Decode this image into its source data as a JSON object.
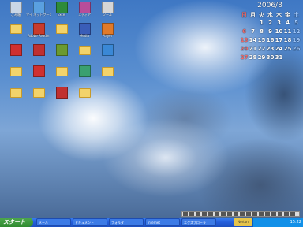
{
  "desktop": {
    "icons": [
      {
        "label": "ごみ箱",
        "color": "#c9d6e6",
        "kind": "app"
      },
      {
        "label": "マイ ネットワーク",
        "color": "#5aa0e0",
        "kind": "app"
      },
      {
        "label": "Excel",
        "color": "#2e8b3a",
        "kind": "app"
      },
      {
        "label": "メディア",
        "color": "#b84d9a",
        "kind": "app"
      },
      {
        "label": "ツール",
        "color": "#d6d6d6",
        "kind": "app"
      },
      {
        "label": "",
        "color": "#f2d36b",
        "kind": "folder"
      },
      {
        "label": "Adobe Reader",
        "color": "#c83a2c",
        "kind": "app"
      },
      {
        "label": "",
        "color": "#f2d36b",
        "kind": "folder"
      },
      {
        "label": "Media",
        "color": "#3a5db8",
        "kind": "app"
      },
      {
        "label": "Player",
        "color": "#e07a2a",
        "kind": "app"
      },
      {
        "label": "",
        "color": "#d03030",
        "kind": "app"
      },
      {
        "label": "",
        "color": "#c03030",
        "kind": "app"
      },
      {
        "label": "",
        "color": "#6a9a30",
        "kind": "app"
      },
      {
        "label": "",
        "color": "#f2d36b",
        "kind": "folder"
      },
      {
        "label": "",
        "color": "#3a88d6",
        "kind": "app"
      },
      {
        "label": "",
        "color": "#f2d36b",
        "kind": "folder"
      },
      {
        "label": "",
        "color": "#d03030",
        "kind": "app"
      },
      {
        "label": "",
        "color": "#f2d36b",
        "kind": "folder"
      },
      {
        "label": "",
        "color": "#3aa070",
        "kind": "app"
      },
      {
        "label": "",
        "color": "#f2d36b",
        "kind": "folder"
      },
      {
        "label": "",
        "color": "#f2d36b",
        "kind": "folder"
      },
      {
        "label": "",
        "color": "#f2d36b",
        "kind": "folder"
      },
      {
        "label": "",
        "color": "#c03030",
        "kind": "app"
      },
      {
        "label": "",
        "color": "#f2d36b",
        "kind": "folder"
      }
    ]
  },
  "calendar": {
    "title": "2006/8",
    "weekdays": [
      "日",
      "月",
      "火",
      "水",
      "木",
      "金",
      "土"
    ],
    "weeks": [
      [
        "",
        "",
        "1",
        "2",
        "3",
        "4",
        "5"
      ],
      [
        "6",
        "7",
        "8",
        "9",
        "10",
        "11",
        "12"
      ],
      [
        "13",
        "14",
        "15",
        "16",
        "17",
        "18",
        "19"
      ],
      [
        "20",
        "21",
        "22",
        "23",
        "24",
        "25",
        "26"
      ],
      [
        "27",
        "28",
        "29",
        "30",
        "31",
        "",
        ""
      ]
    ]
  },
  "taskbar": {
    "start_label": "スタート",
    "buttons": [
      "メール",
      "ドキュメント",
      "フォルダ",
      "Internet",
      "エクスプローラ"
    ],
    "norton_label": "Norton",
    "clock": "15:22"
  },
  "colors": {
    "taskbar": "#245edb",
    "start": "#2f8a2f"
  }
}
